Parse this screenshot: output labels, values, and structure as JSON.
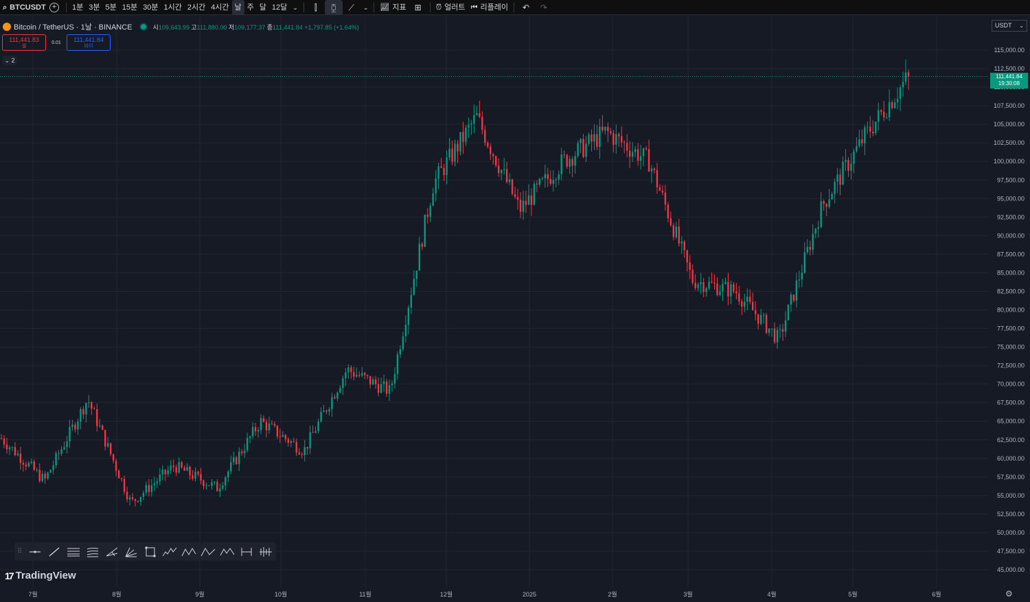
{
  "toolbar": {
    "symbol": "BTCUSDT",
    "timeframes": [
      "1분",
      "3분",
      "5분",
      "15분",
      "30분",
      "1시간",
      "2시간",
      "4시간",
      "날",
      "주",
      "달",
      "12달"
    ],
    "active_timeframe_index": 8,
    "indicators_label": "지표",
    "alert_label": "얼러트",
    "replay_label": "리플레이"
  },
  "legend": {
    "title": "Bitcoin / TetherUS · 1날 · BINANCE",
    "open_label": "시",
    "open": "109,643.99",
    "high_label": "고",
    "high": "111,880.00",
    "low_label": "저",
    "low": "109,177.37",
    "close_label": "종",
    "close": "111,441.84",
    "change": "+1,797.85 (+1.64%)"
  },
  "trade": {
    "sell_price": "111,441.83",
    "sell_label": "셀",
    "spread": "0.01",
    "buy_price": "111,441.84",
    "buy_label": "바이"
  },
  "collapse_label": "2",
  "currency": "USDT",
  "last_price_tag": {
    "price": "111,441.84",
    "countdown": "19:30:08"
  },
  "branding": {
    "logo_mark": "17",
    "wordmark": "TradingView"
  },
  "drawing_tools": [
    "cursor-line-tool",
    "trend-line-tool",
    "parallel-channel-tool",
    "fib-retracement-tool",
    "pitchfork-tool",
    "gann-fan-tool",
    "rectangle-tool",
    "elliott-wave-12345-tool",
    "abcd-pattern-tool",
    "abc-correction-tool",
    "wxy-pattern-tool",
    "date-range-tool",
    "long-position-tool"
  ],
  "colors": {
    "up": "#089981",
    "down": "#f23645",
    "background": "#161a25",
    "grid": "#232632"
  },
  "chart_data": {
    "type": "candlestick",
    "timeframe": "1D",
    "ylim": [
      43500,
      116500
    ],
    "y_ticks": [
      45000,
      47500,
      50000,
      52500,
      55000,
      57500,
      60000,
      62500,
      65000,
      67500,
      70000,
      72500,
      75000,
      77500,
      80000,
      82500,
      85000,
      87500,
      90000,
      92500,
      95000,
      97500,
      100000,
      102500,
      105000,
      107500,
      110000,
      112500,
      115000
    ],
    "x_labels": [
      "7월",
      "8월",
      "9월",
      "10월",
      "11월",
      "12월",
      "2025",
      "2월",
      "3월",
      "4월",
      "5월",
      "6월"
    ],
    "last_price": 111441.84,
    "monthly_anchors": [
      {
        "label": "6월 말",
        "price": 62700
      },
      {
        "label": "7월",
        "price": 57000
      },
      {
        "label": "7월 말",
        "price": 68000
      },
      {
        "label": "8월 초",
        "price": 54000
      },
      {
        "label": "8월 말",
        "price": 59000
      },
      {
        "label": "9월 초",
        "price": 56000
      },
      {
        "label": "9월 말",
        "price": 65000
      },
      {
        "label": "10월 초",
        "price": 61000
      },
      {
        "label": "10월 말",
        "price": 72000
      },
      {
        "label": "11월 초",
        "price": 69000
      },
      {
        "label": "11월 말",
        "price": 97000
      },
      {
        "label": "12월 중",
        "price": 106000
      },
      {
        "label": "12월 말",
        "price": 93500
      },
      {
        "label": "1월 중",
        "price": 100000
      },
      {
        "label": "1월 말",
        "price": 104000
      },
      {
        "label": "2월 초",
        "price": 100000
      },
      {
        "label": "2월 말",
        "price": 84000
      },
      {
        "label": "3월 중",
        "price": 82500
      },
      {
        "label": "4월 초",
        "price": 76000
      },
      {
        "label": "4월 말",
        "price": 94000
      },
      {
        "label": "5월 중",
        "price": 103500
      },
      {
        "label": "5월 말",
        "price": 111441.84
      }
    ]
  }
}
